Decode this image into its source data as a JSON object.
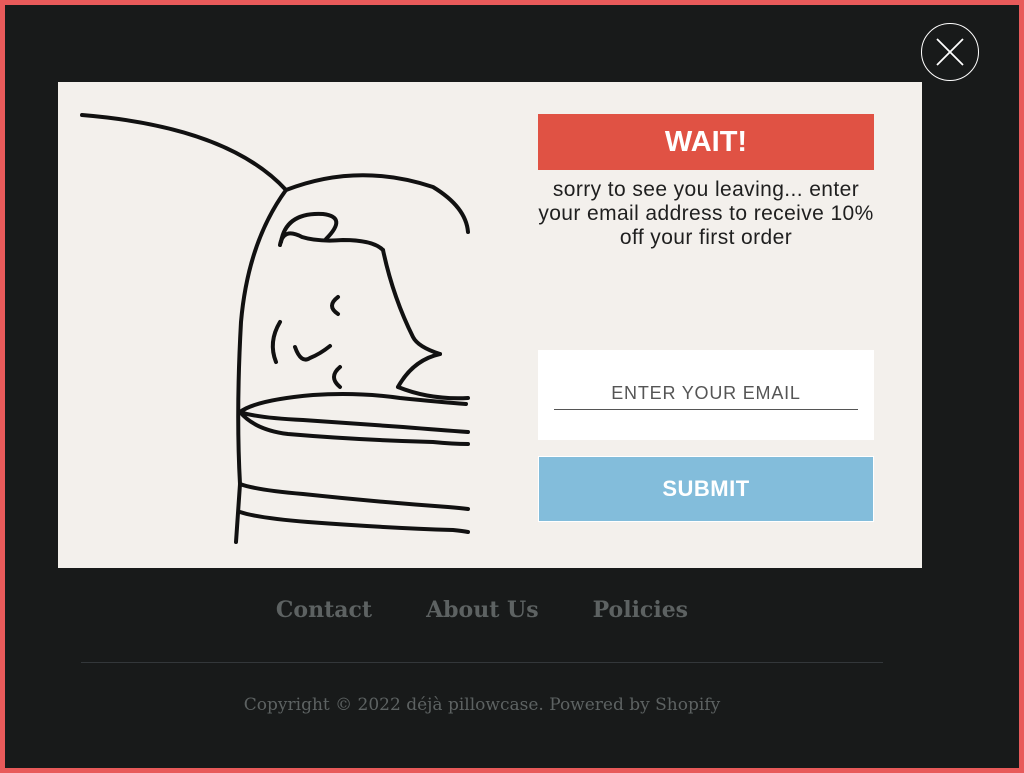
{
  "popup": {
    "title": "WAIT!",
    "message": "sorry to see you leaving... enter your email address to receive 10% off your first order",
    "email_placeholder": "ENTER YOUR EMAIL",
    "submit_label": "SUBMIT",
    "close_icon": "close-x-icon",
    "illustration": "sleeping-person-on-pillow-illustration"
  },
  "footer": {
    "links": [
      {
        "label": "Contact"
      },
      {
        "label": "About Us"
      },
      {
        "label": "Policies"
      }
    ],
    "copyright": "Copyright © 2022 déjà pillowcase. Powered by Shopify"
  },
  "colors": {
    "border": "#e85a5a",
    "background": "#181a1a",
    "modal_bg": "#f3f0ec",
    "wait_banner": "#e05244",
    "submit_button": "#83bddb",
    "footer_text": "#5d6262"
  }
}
